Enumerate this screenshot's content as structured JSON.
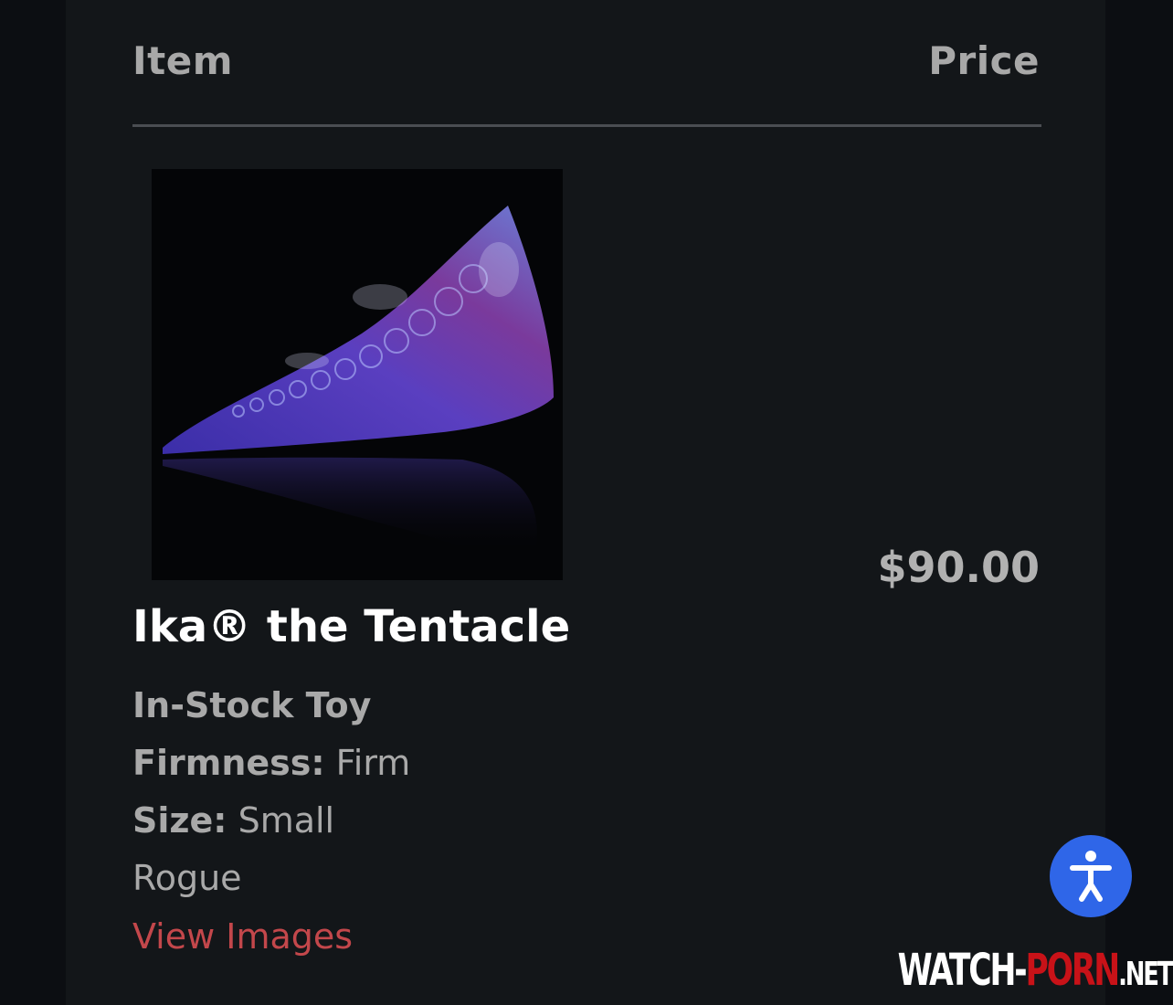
{
  "table_header": {
    "item_label": "Item",
    "price_label": "Price"
  },
  "product": {
    "image_alt": "tentacle-product-image",
    "title": "Ika® the Tentacle",
    "stock_status": "In-Stock Toy",
    "firmness_label": "Firmness:",
    "firmness_value": "Firm",
    "size_label": "Size:",
    "size_value": "Small",
    "color": "Rogue",
    "view_images_label": "View Images",
    "price": "$90.00"
  },
  "accessibility_button": {
    "icon": "accessibility-icon"
  },
  "watermark": {
    "part1": "WATCH-",
    "part2": "PORN",
    "part3": ".NET"
  },
  "colors": {
    "background": "#131619",
    "link": "#c3474b",
    "accessibility": "#2f66e8"
  }
}
